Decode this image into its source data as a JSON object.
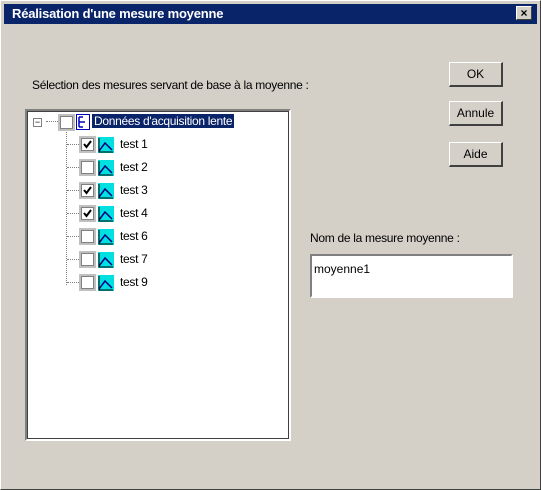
{
  "window": {
    "title": "Réalisation d'une mesure moyenne",
    "close_glyph": "×"
  },
  "labels": {
    "selection": "Sélection des mesures servant de base à la moyenne :",
    "name": "Nom de la mesure moyenne :"
  },
  "buttons": {
    "ok": "OK",
    "cancel": "Annule",
    "help": "Aide"
  },
  "name_field": {
    "value": "moyenne1"
  },
  "tree": {
    "root": {
      "label": "Données d'acquisition lente",
      "checked": false,
      "expanded": true
    },
    "items": [
      {
        "label": "test 1",
        "checked": true
      },
      {
        "label": "test 2",
        "checked": false
      },
      {
        "label": "test 3",
        "checked": true
      },
      {
        "label": "test 4",
        "checked": true
      },
      {
        "label": "test 6",
        "checked": false
      },
      {
        "label": "test 7",
        "checked": false
      },
      {
        "label": "test 9",
        "checked": false
      }
    ]
  },
  "colors": {
    "titlebar": "#0a246a",
    "face": "#d4d0c8",
    "icon_cyan": "#00e0e0"
  }
}
